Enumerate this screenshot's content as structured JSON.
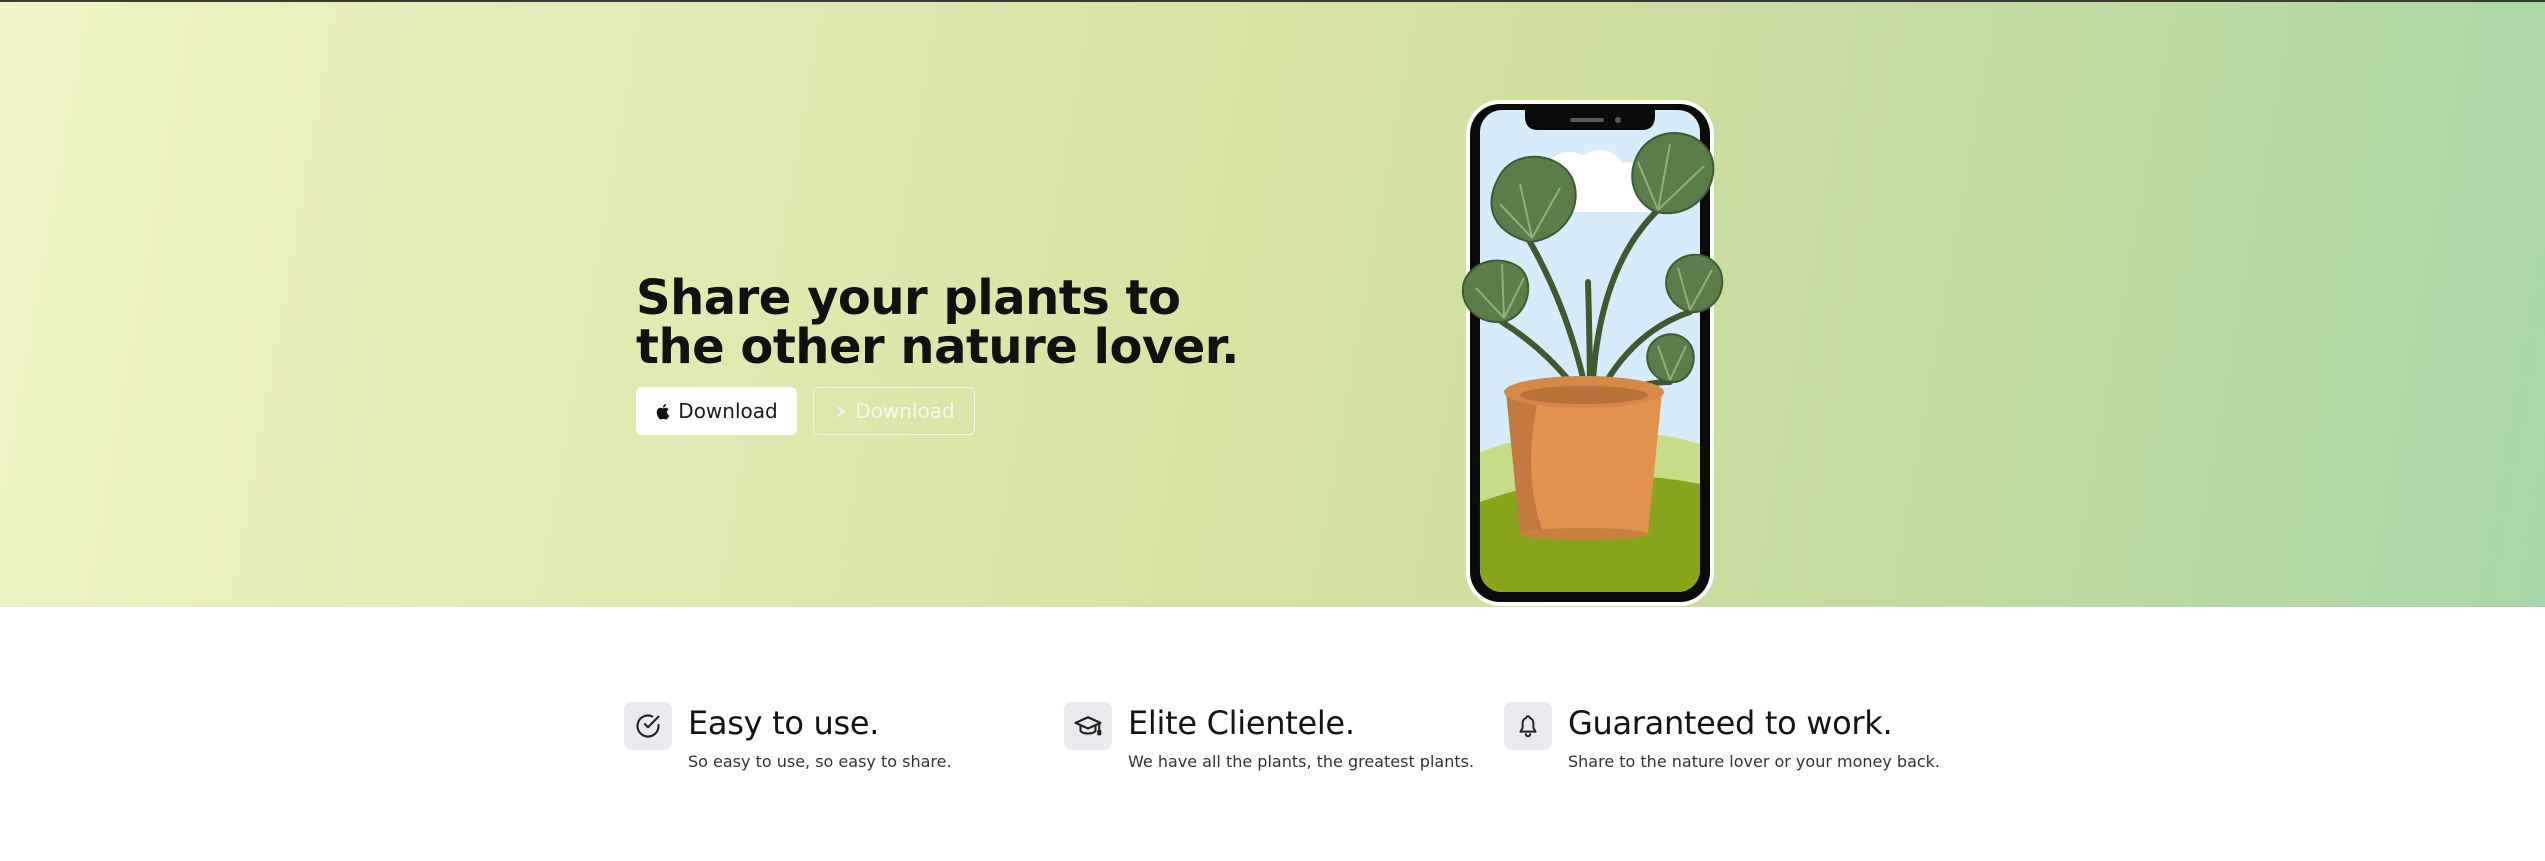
{
  "hero": {
    "title": "Share your plants to the other nature lover.",
    "buttons": [
      {
        "label": "Download",
        "icon": "apple-icon"
      },
      {
        "label": "Download",
        "icon": "play-icon"
      }
    ],
    "illustration": "phone-with-monstera-plant"
  },
  "features": [
    {
      "icon": "check-circle-icon",
      "title": "Easy to use.",
      "description": "So easy to use, so easy to share."
    },
    {
      "icon": "graduation-cap-icon",
      "title": "Elite Clientele.",
      "description": "We have all the plants, the greatest plants."
    },
    {
      "icon": "bell-icon",
      "title": "Guaranteed to work.",
      "description": "Share to the nature lover or your money back."
    }
  ],
  "colors": {
    "hero_gradient_start": "#eff3c6",
    "hero_gradient_end": "#a8d5a8",
    "button_light_bg": "#ffffff",
    "pot": "#e0924e",
    "leaf": "#5a7d4a"
  }
}
